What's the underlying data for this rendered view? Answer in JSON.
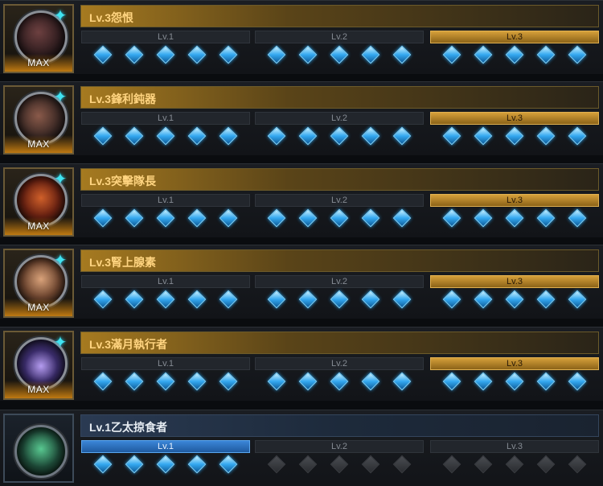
{
  "rows": [
    {
      "title": "Lv.3怨恨",
      "max_label": "MAX",
      "tiers": [
        "Lv.1",
        "Lv.2",
        "Lv.3"
      ]
    },
    {
      "title": "Lv.3鋒利鈍器",
      "max_label": "MAX",
      "tiers": [
        "Lv.1",
        "Lv.2",
        "Lv.3"
      ]
    },
    {
      "title": "Lv.3突擊隊長",
      "max_label": "MAX",
      "tiers": [
        "Lv.1",
        "Lv.2",
        "Lv.3"
      ]
    },
    {
      "title": "Lv.3腎上腺素",
      "max_label": "MAX",
      "tiers": [
        "Lv.1",
        "Lv.2",
        "Lv.3"
      ]
    },
    {
      "title": "Lv.3滿月執行者",
      "max_label": "MAX",
      "tiers": [
        "Lv.1",
        "Lv.2",
        "Lv.3"
      ]
    },
    {
      "title": "Lv.1乙太掠食者",
      "max_label": "",
      "tiers": [
        "Lv.1",
        "Lv.2",
        "Lv.3"
      ]
    }
  ]
}
